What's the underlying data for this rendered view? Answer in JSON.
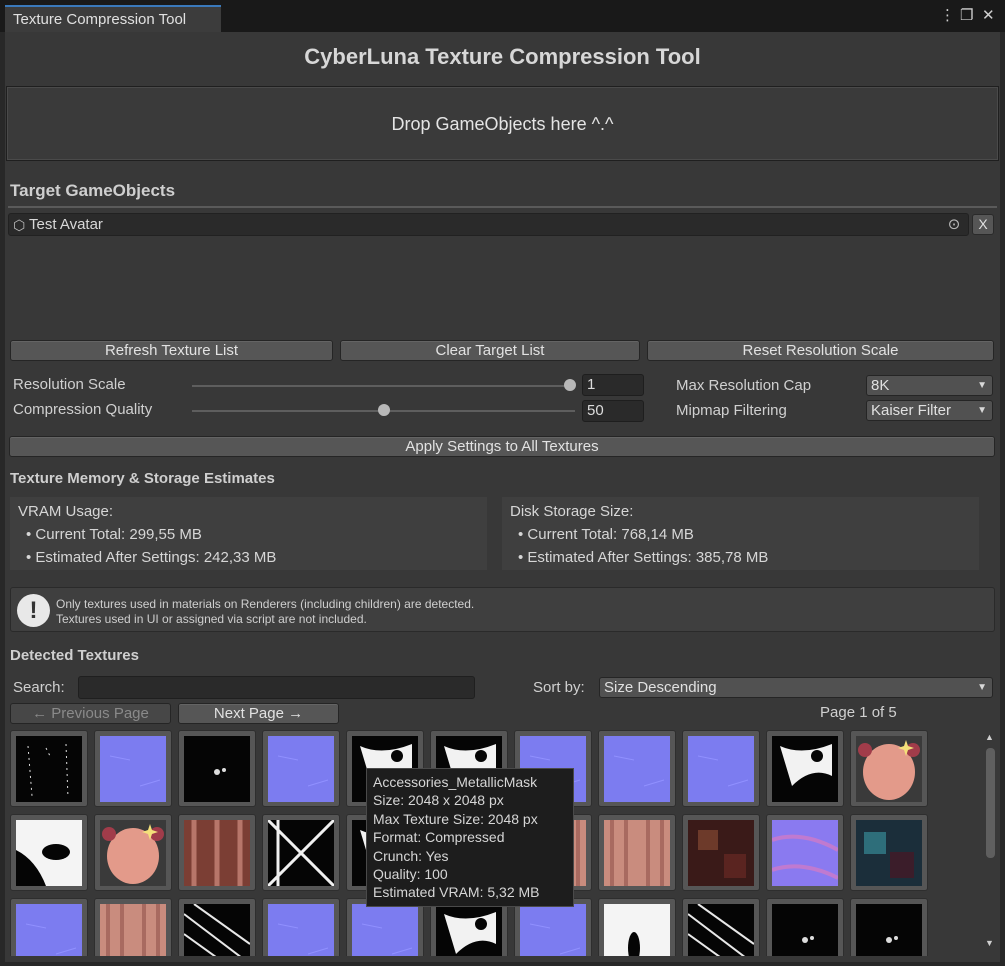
{
  "window": {
    "tab_title": "Texture Compression Tool",
    "menu_glyph": "⋮",
    "maximize_glyph": "❐",
    "close_glyph": "✕"
  },
  "header": {
    "title": "CyberLuna Texture Compression Tool",
    "drop_zone_text": "Drop GameObjects here ^.^"
  },
  "targets": {
    "heading": "Target GameObjects",
    "items": [
      {
        "name": "Test Avatar",
        "remove_label": "X"
      }
    ]
  },
  "actions": {
    "refresh": "Refresh Texture List",
    "clear": "Clear Target List",
    "reset": "Reset Resolution Scale",
    "apply": "Apply Settings to All Textures"
  },
  "settings": {
    "resolution_scale": {
      "label": "Resolution Scale",
      "value": "1",
      "fraction": 1.0
    },
    "compression_quality": {
      "label": "Compression Quality",
      "value": "50",
      "fraction": 0.5
    },
    "max_resolution_cap": {
      "label": "Max Resolution Cap",
      "selected": "8K"
    },
    "mipmap_filtering": {
      "label": "Mipmap Filtering",
      "selected": "Kaiser Filter"
    }
  },
  "estimates": {
    "heading": "Texture Memory & Storage Estimates",
    "vram": {
      "title": "VRAM Usage:",
      "current": "• Current Total: 299,55 MB",
      "after": "• Estimated After Settings: 242,33 MB"
    },
    "disk": {
      "title": "Disk Storage Size:",
      "current": "• Current Total: 768,14 MB",
      "after": "• Estimated After Settings: 385,78 MB"
    }
  },
  "notice": {
    "icon": "!",
    "line1": "Only textures used in materials on Renderers (including children) are detected.",
    "line2": "Textures used in UI or assigned via script are not included."
  },
  "textures": {
    "heading": "Detected Textures",
    "search_label": "Search:",
    "search_value": "",
    "sort_label": "Sort by:",
    "sort_selected": "Size Descending",
    "prev_label": "← Previous Page",
    "next_label": "Next Page →",
    "page_text": "Page 1 of 5"
  },
  "tooltip": {
    "name": "Accessories_MetallicMask",
    "size": "Size: 2048 x 2048 px",
    "max_size": "Max Texture Size: 2048 px",
    "format": "Format: Compressed",
    "crunch": "Crunch: Yes",
    "quality": "Quality: 100",
    "vram": "Estimated VRAM: 5,32 MB"
  },
  "colors": {
    "accent_tab": "#3a79bb",
    "normal_map": "#7c7cf0",
    "skin": "#e39a8a"
  }
}
